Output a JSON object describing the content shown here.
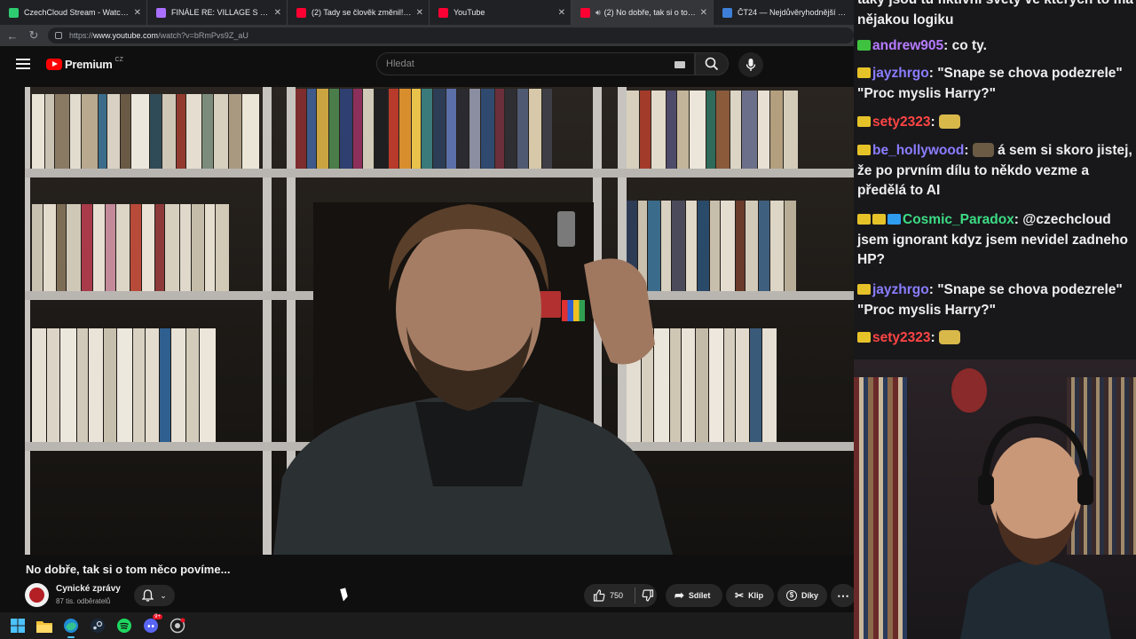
{
  "browser": {
    "tabs": [
      {
        "title": "CzechCloud Stream - Watch Live o",
        "active": false,
        "icon_color": "#2ecc71"
      },
      {
        "title": "FINÁLE RE: VILLAGE S ČEŠTINOU",
        "active": false,
        "icon_color": "#a970ff"
      },
      {
        "title": "(2) Tady se člověk změnil! - YouTube",
        "active": false,
        "icon_color": "#ff0033"
      },
      {
        "title": "YouTube",
        "active": false,
        "icon_color": "#ff0033"
      },
      {
        "title": "(2) No dobře, tak si o tom ně",
        "active": true,
        "icon_color": "#ff0033"
      },
      {
        "title": "ČT24 — Nejdůvěryhodnější zpravo",
        "active": false,
        "icon_color": "#3d7fd8"
      }
    ],
    "url_scheme": "https://",
    "url_host": "www.youtube.com",
    "url_path": "/watch?v=bRmPvs9Z_aU"
  },
  "youtube": {
    "logo_text": "Premium",
    "region": "CZ",
    "search_placeholder": "Hledat",
    "video_title": "No dobře, tak si o tom něco povíme...",
    "channel_name": "Cynické zprávy",
    "channel_subs": "87 tis. odběratelů",
    "likes": "750",
    "share_label": "Sdílet",
    "clip_label": "Klip",
    "thanks_label": "Díky"
  },
  "taskbar": {
    "icons": [
      "windows-start-icon",
      "file-explorer-icon",
      "edge-browser-icon",
      "steam-icon",
      "spotify-icon",
      "discord-icon",
      "github-desktop-icon"
    ],
    "discord_badge": "9+"
  },
  "chat": {
    "messages": [
      {
        "user": "",
        "color": "#efeff1",
        "badges": [],
        "text": "taky jsou tu fiktivní světy ve kterých to má nějakou logiku"
      },
      {
        "user": "andrew905",
        "color": "#b57cff",
        "badges": [
          "#3fc23f"
        ],
        "text": "co ty."
      },
      {
        "user": "jayzhrgo",
        "color": "#8a7dff",
        "badges": [
          "#e6c229"
        ],
        "text": "\"Snape se chova podezrele\" \"Proc myslis Harry?\""
      },
      {
        "user": "sety2323",
        "color": "#ff4545",
        "badges": [
          "#e6c229"
        ],
        "text": "",
        "emote": true
      },
      {
        "user": "be_hollywood",
        "color": "#8a7dff",
        "badges": [
          "#e6c229"
        ],
        "text": "á sem si skoro jistej, že po prvním dílu to někdo vezme a předělá to AI",
        "emote_prefix": true
      },
      {
        "user": "Cosmic_Paradox",
        "color": "#3ddc84",
        "badges": [
          "#e6c229",
          "#e6c229",
          "#2f9cf0"
        ],
        "text": "@czechcloud jsem ignorant kdyz jsem nevidel zadneho HP?"
      },
      {
        "user": "jayzhrgo",
        "color": "#8a7dff",
        "badges": [
          "#e6c229"
        ],
        "text": "\"Snape se chova podezrele\" \"Proc myslis Harry?\""
      },
      {
        "user": "sety2323",
        "color": "#ff4545",
        "badges": [
          "#e6c229"
        ],
        "text": "",
        "emote": true
      }
    ]
  },
  "colors": {
    "youtube_red": "#ff0000",
    "chat_bg": "#18181b",
    "yt_bg": "#0f0f0f"
  }
}
